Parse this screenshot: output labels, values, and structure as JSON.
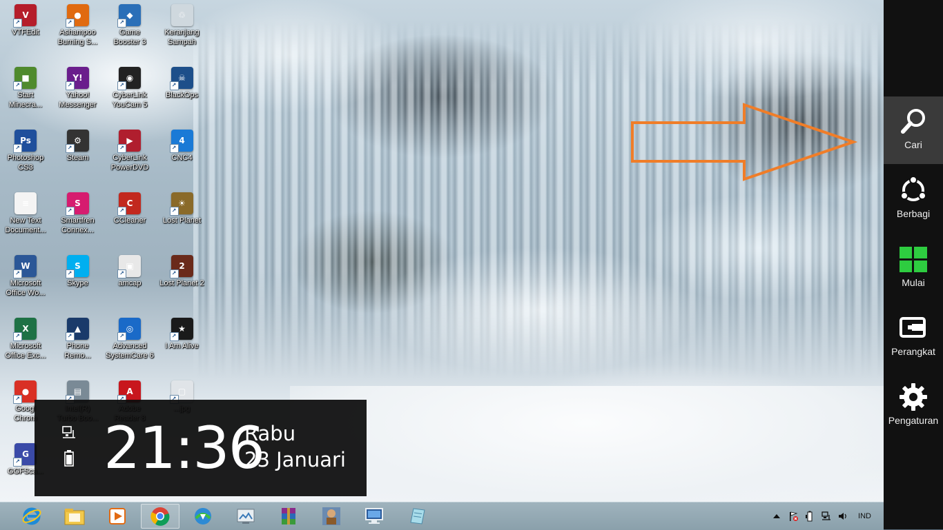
{
  "desktop": {
    "icons": [
      {
        "label": "VTFEdit",
        "color": "#b51d2a",
        "glyph": "V"
      },
      {
        "label": "Ashampoo\nBurning S...",
        "color": "#e06a10",
        "glyph": "●"
      },
      {
        "label": "Game\nBooster 3",
        "color": "#2a6fb8",
        "glyph": "◆"
      },
      {
        "label": "Keranjang\nSampah",
        "color": "#cfd8de",
        "glyph": "♲"
      },
      {
        "label": "Start\nMinecra...",
        "color": "#4f8a2d",
        "glyph": "■"
      },
      {
        "label": "Yahoo!\nMessenger",
        "color": "#6a1e8c",
        "glyph": "Y!"
      },
      {
        "label": "CyberLink\nYouCam 5",
        "color": "#222222",
        "glyph": "◉"
      },
      {
        "label": "BlackOps",
        "color": "#1d4f8a",
        "glyph": "☠"
      },
      {
        "label": "Photoshop\nCS3",
        "color": "#1f4f9c",
        "glyph": "Ps"
      },
      {
        "label": "Steam",
        "color": "#333333",
        "glyph": "⚙"
      },
      {
        "label": "CyberLink\nPowerDVD",
        "color": "#b01e2e",
        "glyph": "▶"
      },
      {
        "label": "CNC4",
        "color": "#1a7ad6",
        "glyph": "4"
      },
      {
        "label": "New Text\nDocument...",
        "color": "#f4f4f4",
        "glyph": "≡"
      },
      {
        "label": "Smartfren\nConnex...",
        "color": "#d61c6f",
        "glyph": "S"
      },
      {
        "label": "CCleaner",
        "color": "#c2281e",
        "glyph": "C"
      },
      {
        "label": "Lost Planet",
        "color": "#8a6a2a",
        "glyph": "☀"
      },
      {
        "label": "Microsoft\nOffice Wo...",
        "color": "#2b5797",
        "glyph": "W"
      },
      {
        "label": "Skype",
        "color": "#00aff0",
        "glyph": "S"
      },
      {
        "label": "amcap",
        "color": "#e8e8e8",
        "glyph": "▣"
      },
      {
        "label": "Lost Planet 2",
        "color": "#6a2a1a",
        "glyph": "2"
      },
      {
        "label": "Microsoft\nOffice Exc...",
        "color": "#1e7145",
        "glyph": "X"
      },
      {
        "label": "Phone\nRemo...",
        "color": "#1a3a6a",
        "glyph": "▲"
      },
      {
        "label": "Advanced\nSystemCare 6",
        "color": "#1a6ac8",
        "glyph": "◎"
      },
      {
        "label": "I Am Alive",
        "color": "#1a1a1a",
        "glyph": "★"
      },
      {
        "label": "Googl\nChrom",
        "color": "#d93025",
        "glyph": "●"
      },
      {
        "label": "Intel(R)\nTurbo Boo...",
        "color": "#7a8a96",
        "glyph": "▤"
      },
      {
        "label": "Adobe\nReader 8",
        "color": "#c8161d",
        "glyph": "A"
      },
      {
        "label": "...jpg",
        "color": "#e0e4e8",
        "glyph": "▢"
      },
      {
        "label": "GGFSca...",
        "color": "#3a4aa8",
        "glyph": "G"
      }
    ]
  },
  "overlay": {
    "time": "21:36",
    "day": "Rabu",
    "date": "23 Januari"
  },
  "charms": {
    "items": [
      {
        "label": "Cari",
        "icon": "search-icon"
      },
      {
        "label": "Berbagi",
        "icon": "share-icon"
      },
      {
        "label": "Mulai",
        "icon": "windows-logo-icon"
      },
      {
        "label": "Perangkat",
        "icon": "devices-icon"
      },
      {
        "label": "Pengaturan",
        "icon": "settings-gear-icon"
      }
    ]
  },
  "taskbar": {
    "apps": [
      {
        "name": "Internet Explorer",
        "icon": "internet-explorer-icon"
      },
      {
        "name": "File Explorer",
        "icon": "file-explorer-icon"
      },
      {
        "name": "Media Player",
        "icon": "media-player-icon"
      },
      {
        "name": "Google Chrome",
        "icon": "chrome-icon"
      },
      {
        "name": "Internet Download Manager",
        "icon": "download-manager-icon"
      },
      {
        "name": "Screenshot Tool",
        "icon": "screenshot-tool-icon"
      },
      {
        "name": "WinRAR",
        "icon": "winrar-icon"
      },
      {
        "name": "Game",
        "icon": "game-character-icon"
      },
      {
        "name": "Remote Desktop",
        "icon": "remote-desktop-icon"
      },
      {
        "name": "Notes",
        "icon": "notes-icon"
      }
    ],
    "tray": {
      "language": "IND"
    }
  },
  "colors": {
    "accent_arrow": "#f07d28",
    "charms_bg": "#111111",
    "charm_active": "#3a3a3a",
    "windows_logo": "#2ecc40",
    "taskbar_bg": "#8fa5b0"
  }
}
